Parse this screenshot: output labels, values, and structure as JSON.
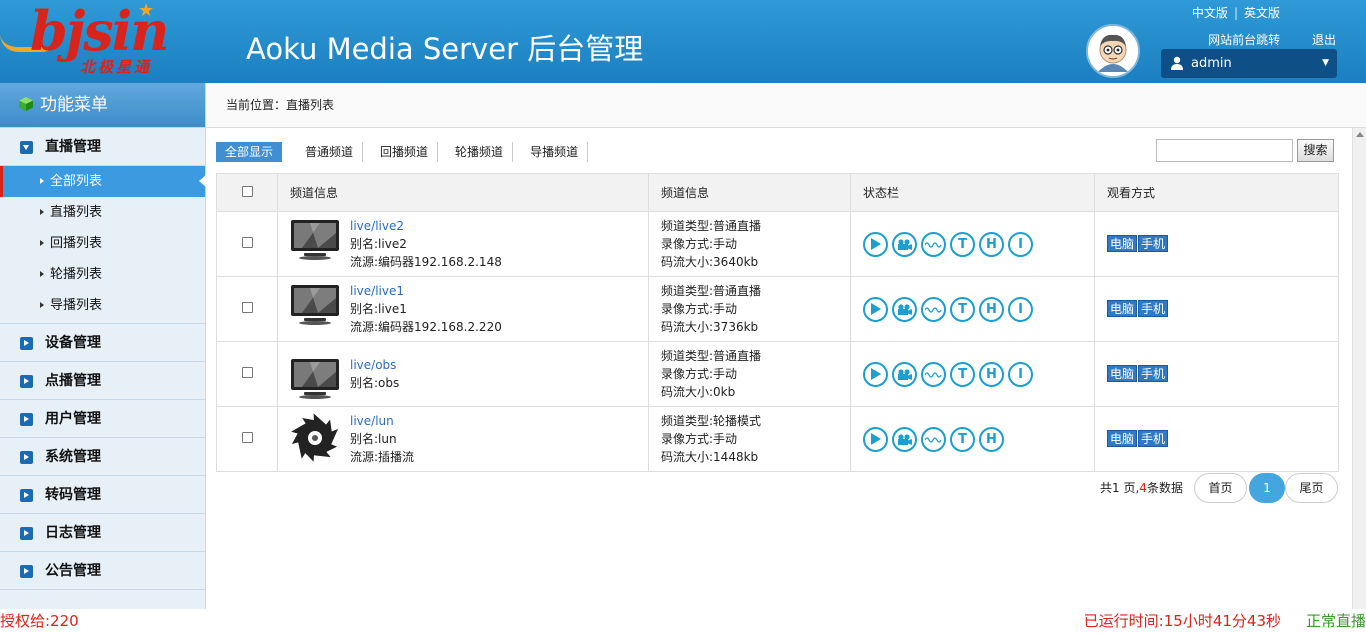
{
  "header": {
    "logo_text": "bjsin",
    "logo_sub": "北极星通",
    "app_title": "Aoku Media Server 后台管理",
    "lang_cn": "中文版",
    "lang_en": "英文版",
    "front_link": "网站前台跳转",
    "logout": "退出",
    "user": "admin",
    "colors": {
      "header": "#2383c6",
      "accent": "#d9241b"
    }
  },
  "sidebar": {
    "title": "功能菜单",
    "groups": [
      {
        "label": "直播管理",
        "open": true,
        "items": [
          {
            "label": "全部列表",
            "active": true
          },
          {
            "label": "直播列表"
          },
          {
            "label": "回播列表"
          },
          {
            "label": "轮播列表"
          },
          {
            "label": "导播列表"
          }
        ]
      },
      {
        "label": "设备管理"
      },
      {
        "label": "点播管理"
      },
      {
        "label": "用户管理"
      },
      {
        "label": "系统管理"
      },
      {
        "label": "转码管理"
      },
      {
        "label": "日志管理"
      },
      {
        "label": "公告管理"
      }
    ]
  },
  "breadcrumb": "当前位置：直播列表",
  "filters": [
    "全部显示",
    "普通频道",
    "回播频道",
    "轮播频道",
    "导播频道"
  ],
  "search": {
    "placeholder": "",
    "button": "搜索"
  },
  "table": {
    "headers": [
      "",
      "频道信息",
      "频道信息",
      "状态栏",
      "观看方式"
    ],
    "rows": [
      {
        "name": "live/live2",
        "alias": "别名:live2",
        "source": "流源:编码器192.168.2.148",
        "type": "频道类型:普通直播",
        "record": "录像方式:手动",
        "bitrate": "码流大小:3640kb",
        "thumb": "monitor-icon",
        "icons": [
          "▶",
          "cam",
          "~",
          "T",
          "H",
          "I"
        ]
      },
      {
        "name": "live/live1",
        "alias": "别名:live1",
        "source": "流源:编码器192.168.2.220",
        "type": "频道类型:普通直播",
        "record": "录像方式:手动",
        "bitrate": "码流大小:3736kb",
        "thumb": "monitor-icon",
        "icons": [
          "▶",
          "cam",
          "~",
          "T",
          "H",
          "I"
        ]
      },
      {
        "name": "live/obs",
        "alias": "别名:obs",
        "source": "",
        "type": "频道类型:普通直播",
        "record": "录像方式:手动",
        "bitrate": "码流大小:0kb",
        "thumb": "monitor-icon",
        "icons": [
          "▶",
          "cam",
          "~",
          "T",
          "H",
          "I"
        ]
      },
      {
        "name": "live/lun",
        "alias": "别名:lun",
        "source": "流源:插播流",
        "type": "频道类型:轮播模式",
        "record": "录像方式:手动",
        "bitrate": "码流大小:1448kb",
        "thumb": "shutter-icon",
        "icons": [
          "▶",
          "cam",
          "~",
          "T",
          "H"
        ]
      }
    ],
    "watch": {
      "pc": "电脑",
      "mobile": "手机"
    }
  },
  "pagination": {
    "prefix": "共",
    "pages": "1",
    "mid": " 页,",
    "count": "4",
    "suffix": "条数据",
    "first": "首页",
    "current": "1",
    "last": "尾页"
  },
  "footer": {
    "license": "授权给:220",
    "uptime": "已运行时间:15小时41分43秒",
    "status": "正常直播"
  }
}
